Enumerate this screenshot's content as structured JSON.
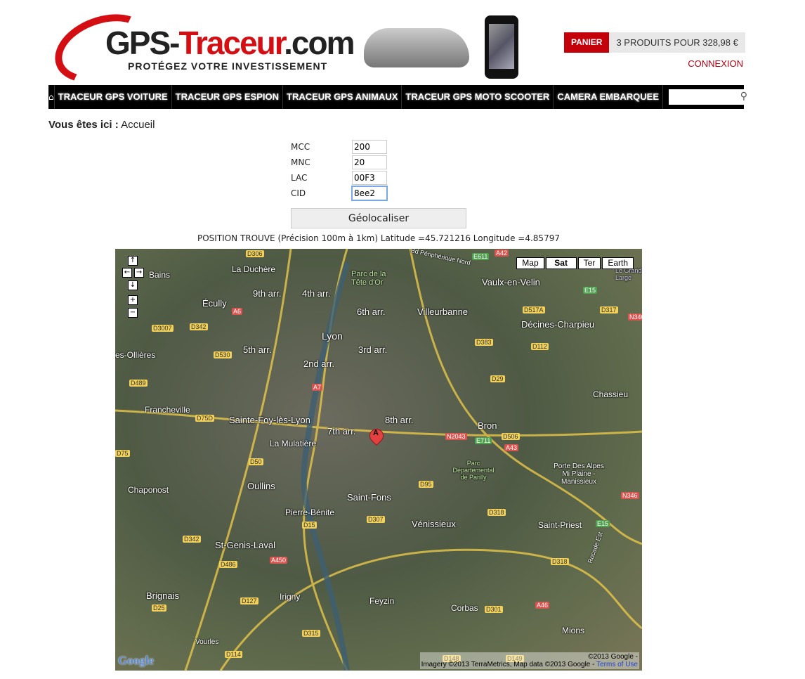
{
  "header": {
    "logo_text_dark": "GPS-",
    "logo_text_red": "Traceur",
    "logo_text_suffix": ".com",
    "logo_tagline": "PROTÉGEZ VOTRE INVESTISSEMENT",
    "cart_label": "PANIER",
    "cart_info": "3 PRODUITS POUR 328,98 €",
    "login": "CONNEXION"
  },
  "nav": {
    "home_icon": "home-icon",
    "items": [
      "TRACEUR GPS VOITURE",
      "TRACEUR GPS ESPION",
      "TRACEUR GPS ANIMAUX",
      "TRACEUR GPS MOTO SCOOTER",
      "CAMERA EMBARQUEE"
    ],
    "search_placeholder": "",
    "search_icon": "magnifier-icon"
  },
  "breadcrumb": {
    "prefix": "Vous êtes ici :",
    "current": "Accueil"
  },
  "form": {
    "fields": [
      {
        "label": "MCC",
        "value": "200"
      },
      {
        "label": "MNC",
        "value": "20"
      },
      {
        "label": "LAC",
        "value": "00F3"
      },
      {
        "label": "CID",
        "value": "8ee2"
      }
    ],
    "button": "Géolocaliser"
  },
  "result": "POSITION TROUVE (Précision 100m à 1km) Latitude =45.721216 Longitude =4.85797",
  "map": {
    "types": [
      "Map",
      "Sat",
      "Ter",
      "Earth"
    ],
    "selected_type": "Sat",
    "marker_letter": "A",
    "places": [
      "La Duchère",
      "9th arr.",
      "4th arr.",
      "Parc de la Tête d'Or",
      "Vaulx-en-Velin",
      "Écully",
      "6th arr.",
      "Villeurbanne",
      "Décines-Charpieu",
      "Lyon",
      "5th arr.",
      "3rd arr.",
      "2nd arr.",
      "Chassieu",
      "Francheville",
      "Sainte-Foy-lès-Lyon",
      "7th arr.",
      "8th arr.",
      "Bron",
      "La Mulatière",
      "Parc Départemental de Parilly",
      "Porte Des Alpes Mi Plaine - Manissieux",
      "Chaponost",
      "Oullins",
      "Saint-Fons",
      "Pierre-Bénite",
      "Vénissieux",
      "Saint-Priest",
      "St-Genis-Laval",
      "Brignais",
      "Irigny",
      "Feyzin",
      "Corbas",
      "Mions",
      "Vourles",
      "Bains",
      "es-Ollières",
      "Le Grand Large",
      "Bd Périphérique Nord",
      "Rocade Est"
    ],
    "roads": [
      "D306",
      "A42",
      "E611",
      "E15",
      "D317",
      "D517A",
      "N346",
      "D3007",
      "D342",
      "A6",
      "D530",
      "D383",
      "D112",
      "D489",
      "A7",
      "D29",
      "D75D",
      "D506",
      "E711",
      "A43",
      "N2043",
      "D75",
      "D50",
      "D95",
      "D318",
      "D15",
      "D307",
      "N346",
      "E15",
      "D342",
      "D486",
      "A450",
      "D318",
      "D25",
      "D127",
      "A46",
      "D301",
      "D315",
      "D114",
      "D148",
      "D149"
    ],
    "copyright": "©2013 Google -",
    "attribution": "Imagery ©2013 TerraMetrics, Map data ©2013 Google -",
    "terms": "Terms of Use",
    "google_logo": "Google"
  }
}
